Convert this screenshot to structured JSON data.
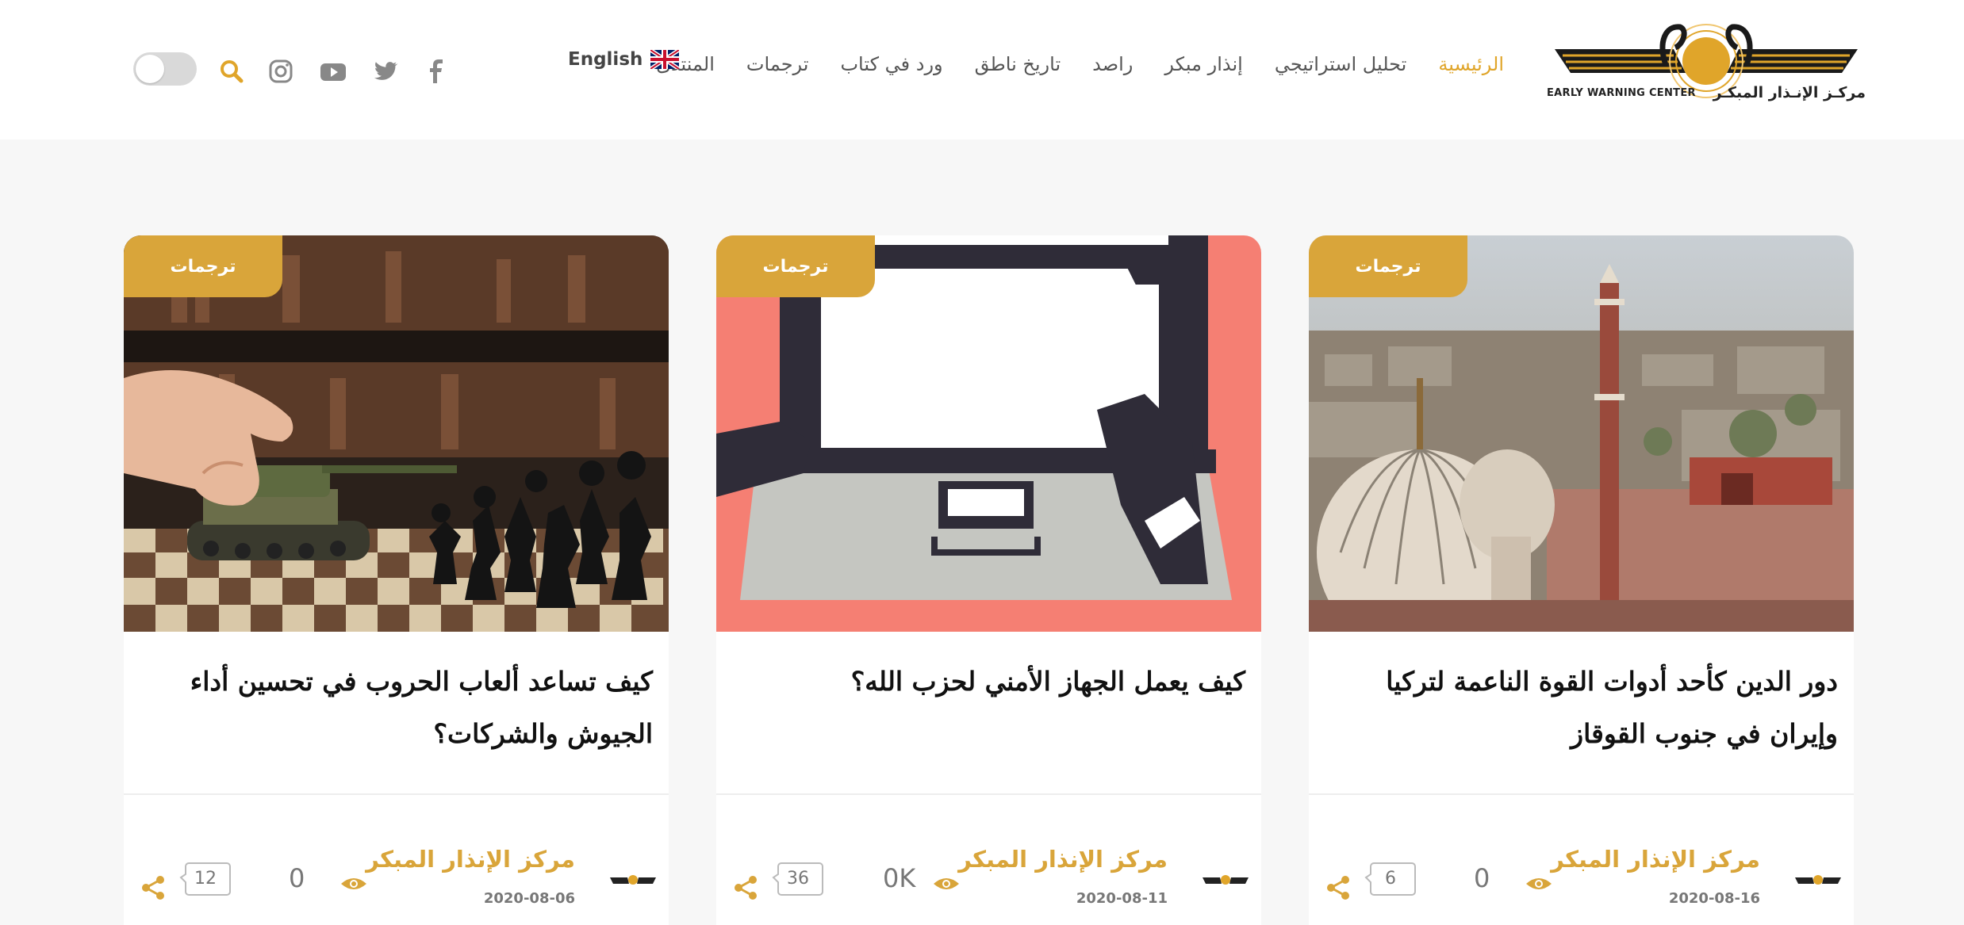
{
  "logo": {
    "text_en": "EARLY WARNING CENTER",
    "text_ar": "مركـز الإنـذار المبكـر"
  },
  "nav": {
    "items": [
      {
        "label": "الرئيسية",
        "active": true
      },
      {
        "label": "تحليل استراتيجي"
      },
      {
        "label": "إنذار مبكر"
      },
      {
        "label": "راصد"
      },
      {
        "label": "تاريخ ناطق"
      },
      {
        "label": "ورد في كتاب"
      },
      {
        "label": "ترجمات"
      },
      {
        "label": "المنتدى"
      }
    ]
  },
  "language": {
    "label": "English"
  },
  "icons": {
    "social": [
      "facebook-icon",
      "twitter-icon",
      "youtube-icon",
      "instagram-icon"
    ],
    "search": "search-icon",
    "toggle": "theme-toggle"
  },
  "colors": {
    "accent": "#d9a53a",
    "nav_active": "#e0a52a"
  },
  "cards": [
    {
      "category": "ترجمات",
      "title": "دور الدين كأحد أدوات القوة الناعمة لتركيا وإيران في جنوب القوقاز",
      "author": "مركز الإنذار المبكر",
      "date": "2020-08-16",
      "views": "0",
      "comments": "6"
    },
    {
      "category": "ترجمات",
      "title": "كيف يعمل الجهاز الأمني لحزب الله؟",
      "author": "مركز الإنذار المبكر",
      "date": "2020-08-11",
      "views": "0K",
      "comments": "36"
    },
    {
      "category": "ترجمات",
      "title": "كيف تساعد ألعاب الحروب في تحسين أداء الجيوش والشركات؟",
      "author": "مركز الإنذار المبكر",
      "date": "2020-08-06",
      "views": "0",
      "comments": "12"
    }
  ]
}
